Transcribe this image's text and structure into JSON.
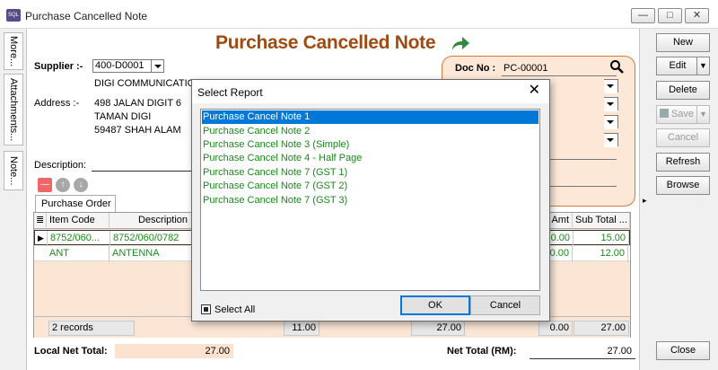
{
  "window": {
    "title": "Purchase Cancelled Note",
    "icon_name": "sql-app-icon",
    "controls": {
      "minimize": "—",
      "maximize": "□",
      "close": "✕"
    }
  },
  "left_tabs": [
    "More...",
    "Attachments...",
    "Note..."
  ],
  "form": {
    "heading": "Purchase Cancelled Note",
    "supplier_label": "Supplier :-",
    "supplier_code": "400-D0001",
    "supplier_name": "DIGI COMMUNICATION",
    "address_label": "Address :-",
    "address_lines": [
      "498 JALAN DIGIT 6",
      "TAMAN DIGI",
      "59487 SHAH ALAM"
    ],
    "description_label": "Description:",
    "doc_no_label": "Doc No :",
    "doc_no": "PC-00001",
    "doc_partial_value": "1",
    "tab_label": "Purchase Order",
    "grid": {
      "columns": [
        "Item Code",
        "Description",
        "Amt",
        "Sub Total ..."
      ],
      "rows": [
        {
          "item_code": "8752/060...",
          "description": "8752/060/0782",
          "amt": "0.00",
          "sub_total": "15.00"
        },
        {
          "item_code": "ANT",
          "description": "ANTENNA",
          "amt": "0.00",
          "sub_total": "12.00"
        }
      ],
      "footer": {
        "records": "2 records",
        "qty_partial": "11.00",
        "amount_partial": "27.00",
        "amt": "0.00",
        "sub_total": "27.00"
      }
    },
    "local_net_total_label": "Local Net Total:",
    "local_net_total": "27.00",
    "net_total_label": "Net Total (RM):",
    "net_total": "27.00"
  },
  "right_buttons": {
    "new": "New",
    "edit": "Edit",
    "delete": "Delete",
    "save": "Save",
    "cancel": "Cancel",
    "refresh": "Refresh",
    "browse": "Browse",
    "close": "Close"
  },
  "dialog": {
    "title": "Select Report",
    "close": "✕",
    "items": [
      "Purchase Cancel Note 1",
      "Purchase Cancel Note 2",
      "Purchase Cancel Note 3 (Simple)",
      "Purchase Cancel Note 4 - Half Page",
      "Purchase Cancel Note 7 (GST 1)",
      "Purchase Cancel Note 7 (GST 2)",
      "Purchase Cancel Note 7 (GST 3)"
    ],
    "selected_index": 0,
    "select_all_label": "Select All",
    "ok_label": "OK",
    "cancel_label": "Cancel"
  },
  "colors": {
    "heading": "#a14a10",
    "list_item_text": "#1a8a1a",
    "selection": "#0078d7",
    "doc_panel_bg": "#fde8d8",
    "doc_panel_border": "#d77a3a"
  }
}
